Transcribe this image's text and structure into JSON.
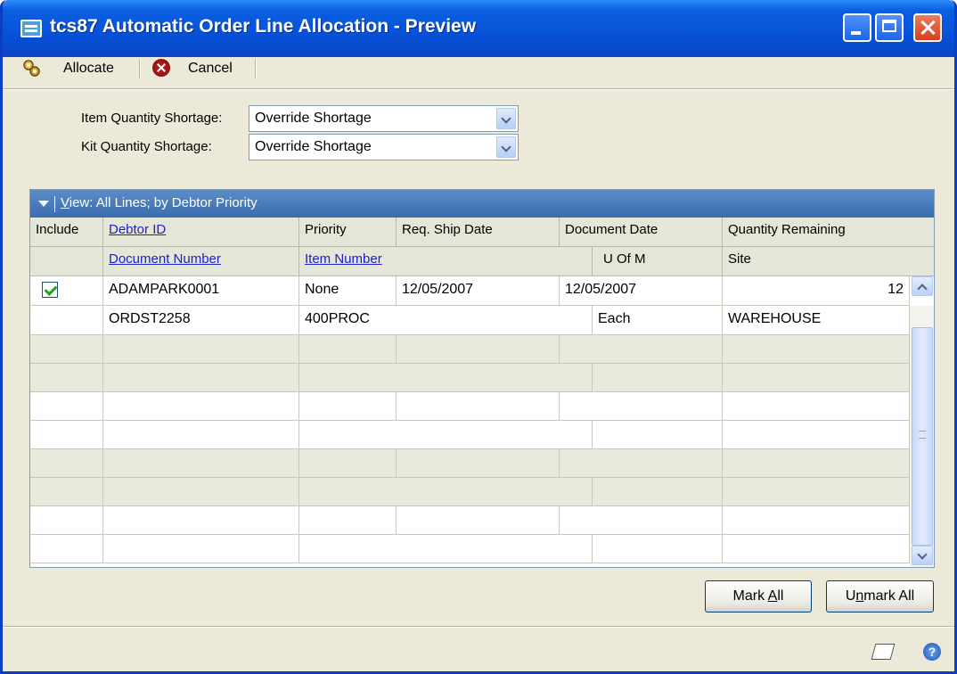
{
  "window": {
    "title": "tcs87 Automatic Order Line Allocation - Preview"
  },
  "toolbar": {
    "allocate_label": "Allocate",
    "cancel_label": "Cancel"
  },
  "form": {
    "item_shortage_label": "Item Quantity Shortage:",
    "item_shortage_value": "Override Shortage",
    "kit_shortage_label": "Kit Quantity Shortage:",
    "kit_shortage_value": "Override Shortage"
  },
  "grid": {
    "view_label_prefix": "V",
    "view_label_rest": "iew: All Lines; by Debtor Priority",
    "headers_row1": [
      "Include",
      "Debtor ID",
      "Priority",
      "Req. Ship Date",
      "Document Date",
      "Quantity Remaining"
    ],
    "headers_row2": [
      "Document Number",
      "Item Number",
      "U Of M",
      "Site"
    ],
    "record": {
      "included": true,
      "debtor_id": "ADAMPARK0001",
      "priority": "None",
      "req_ship_date": "12/05/2007",
      "document_date": "12/05/2007",
      "quantity_remaining": "12",
      "document_number": "ORDST2258",
      "item_number": "400PROC",
      "uofm": "Each",
      "site": "WAREHOUSE"
    }
  },
  "buttons": {
    "mark_all_pre": "Mark ",
    "mark_all_key": "A",
    "mark_all_post": "ll",
    "unmark_all_pre": "U",
    "unmark_all_key": "n",
    "unmark_all_post": "mark All"
  },
  "status": {
    "help_glyph": "?"
  },
  "icons": [
    "app-window-icon",
    "allocate-icon",
    "cancel-icon",
    "dropdown-arrow-icon",
    "collapse-arrow-icon",
    "checkbox-checked-icon",
    "note-icon",
    "help-icon"
  ]
}
